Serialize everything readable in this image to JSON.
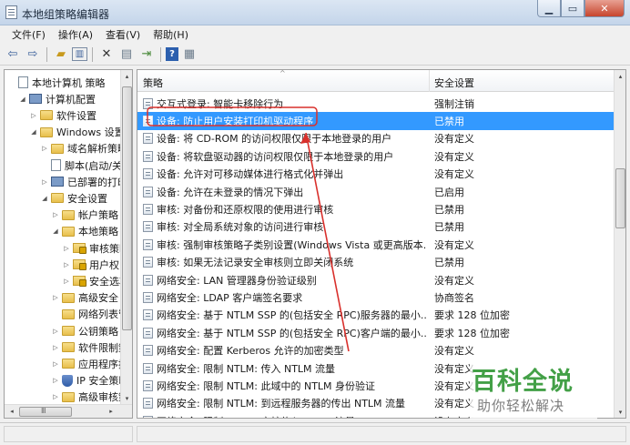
{
  "window": {
    "title": "本地组策略编辑器",
    "controls": [
      "▁",
      "▭",
      "✕"
    ]
  },
  "menu": {
    "items": [
      "文件(F)",
      "操作(A)",
      "查看(V)",
      "帮助(H)"
    ]
  },
  "toolbar": {
    "icons": [
      "back-arrow-icon",
      "forward-arrow-icon",
      "up-folder-icon",
      "show-hide-tree-icon",
      "delete-icon",
      "properties-icon",
      "export-list-icon",
      "help-icon",
      "view-icon"
    ]
  },
  "tree": {
    "items": [
      {
        "label": "本地计算机 策略",
        "indent": 0,
        "icon": "policy-doc-icon",
        "toggle": ""
      },
      {
        "label": "计算机配置",
        "indent": 1,
        "icon": "computer-icon",
        "toggle": "◢"
      },
      {
        "label": "软件设置",
        "indent": 2,
        "icon": "folder-icon",
        "toggle": "▷"
      },
      {
        "label": "Windows 设置",
        "indent": 2,
        "icon": "folder-icon",
        "toggle": "◢"
      },
      {
        "label": "域名解析策略",
        "indent": 3,
        "icon": "folder-icon",
        "toggle": "▷"
      },
      {
        "label": "脚本(启动/关机)",
        "indent": 3,
        "icon": "script-icon",
        "toggle": ""
      },
      {
        "label": "已部署的打印机",
        "indent": 3,
        "icon": "printer-icon",
        "toggle": "▷"
      },
      {
        "label": "安全设置",
        "indent": 3,
        "icon": "security-icon",
        "toggle": "◢"
      },
      {
        "label": "帐户策略",
        "indent": 4,
        "icon": "folder-icon",
        "toggle": "▷"
      },
      {
        "label": "本地策略",
        "indent": 4,
        "icon": "folder-icon",
        "toggle": "◢"
      },
      {
        "label": "审核策略",
        "indent": 5,
        "icon": "lock-folder-icon",
        "toggle": "▷"
      },
      {
        "label": "用户权限分配",
        "indent": 5,
        "icon": "lock-folder-icon",
        "toggle": "▷"
      },
      {
        "label": "安全选项",
        "indent": 5,
        "icon": "lock-folder-icon",
        "toggle": "▷"
      },
      {
        "label": "高级安全 Windows 防火墙",
        "indent": 4,
        "icon": "folder-icon",
        "toggle": "▷"
      },
      {
        "label": "网络列表管理器策略",
        "indent": 4,
        "icon": "folder-icon",
        "toggle": ""
      },
      {
        "label": "公钥策略",
        "indent": 4,
        "icon": "folder-icon",
        "toggle": "▷"
      },
      {
        "label": "软件限制策略",
        "indent": 4,
        "icon": "folder-icon",
        "toggle": "▷"
      },
      {
        "label": "应用程序控制策略",
        "indent": 4,
        "icon": "folder-icon",
        "toggle": "▷"
      },
      {
        "label": "IP 安全策略",
        "indent": 4,
        "icon": "shield-icon",
        "toggle": "▷"
      },
      {
        "label": "高级审核策略配置",
        "indent": 4,
        "icon": "folder-icon",
        "toggle": "▷"
      }
    ]
  },
  "list": {
    "header_policy": "策略",
    "header_setting": "安全设置",
    "rows": [
      {
        "name": "交互式登录: 智能卡移除行为",
        "value": "强制注销"
      },
      {
        "name": "设备: 防止用户安装打印机驱动程序",
        "value": "已禁用",
        "selected": true
      },
      {
        "name": "设备: 将 CD-ROM 的访问权限仅限于本地登录的用户",
        "value": "没有定义"
      },
      {
        "name": "设备: 将软盘驱动器的访问权限仅限于本地登录的用户",
        "value": "没有定义"
      },
      {
        "name": "设备: 允许对可移动媒体进行格式化并弹出",
        "value": "没有定义"
      },
      {
        "name": "设备: 允许在未登录的情况下弹出",
        "value": "已启用"
      },
      {
        "name": "审核: 对备份和还原权限的使用进行审核",
        "value": "已禁用"
      },
      {
        "name": "审核: 对全局系统对象的访问进行审核",
        "value": "已禁用"
      },
      {
        "name": "审核: 强制审核策略子类别设置(Windows Vista 或更高版本...",
        "value": "没有定义"
      },
      {
        "name": "审核: 如果无法记录安全审核则立即关闭系统",
        "value": "已禁用"
      },
      {
        "name": "网络安全: LAN 管理器身份验证级别",
        "value": "没有定义"
      },
      {
        "name": "网络安全: LDAP 客户端签名要求",
        "value": "协商签名"
      },
      {
        "name": "网络安全: 基于 NTLM SSP 的(包括安全 RPC)服务器的最小...",
        "value": "要求 128 位加密"
      },
      {
        "name": "网络安全: 基于 NTLM SSP 的(包括安全 RPC)客户端的最小...",
        "value": "要求 128 位加密"
      },
      {
        "name": "网络安全: 配置 Kerberos 允许的加密类型",
        "value": "没有定义"
      },
      {
        "name": "网络安全: 限制 NTLM: 传入 NTLM 流量",
        "value": "没有定义"
      },
      {
        "name": "网络安全: 限制 NTLM: 此域中的 NTLM 身份验证",
        "value": "没有定义"
      },
      {
        "name": "网络安全: 限制 NTLM: 到远程服务器的传出 NTLM 流量",
        "value": "没有定义"
      },
      {
        "name": "网络安全: 限制 NTLM: 审核传入 NTLM 流量",
        "value": "没有定义"
      }
    ]
  },
  "scrollbars": {
    "tree_horizontal_left": "◂",
    "tree_horizontal_dots": "Ⅲ",
    "tree_horizontal_right": "▸",
    "up": "▴",
    "down": "▾"
  },
  "watermark": {
    "line1": "百科全说",
    "line2": "助你轻松解决"
  },
  "annotation": {
    "color": "#d9302c"
  }
}
